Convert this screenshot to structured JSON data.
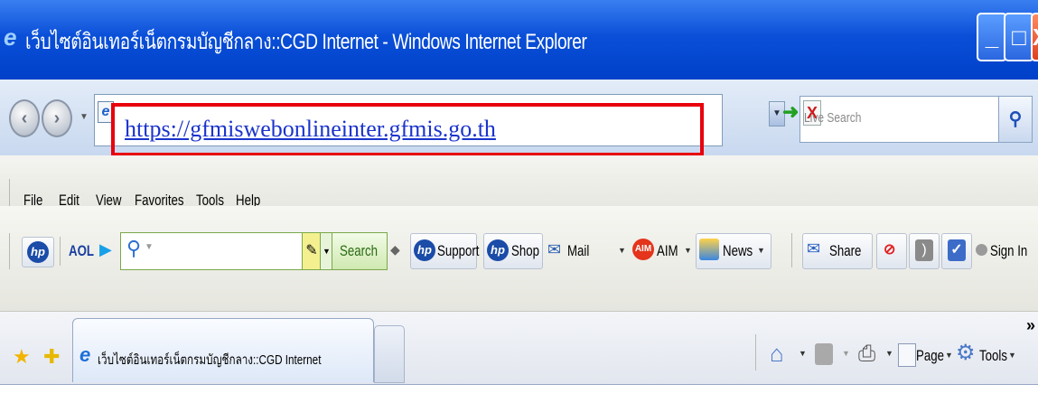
{
  "window": {
    "title": "เว็บไซต์อินเทอร์เน็ตกรมบัญชีกลาง::CGD Internet - Windows Internet Explorer",
    "minimize_label": "_",
    "maximize_label": "□",
    "close_label": "X"
  },
  "address": {
    "url": "https://gfmiswebonlineinter.gfmis.go.th",
    "highlight_color": "#e8000d",
    "search_placeholder": "Live Search"
  },
  "menu": {
    "items": [
      "File",
      "Edit",
      "View",
      "Favorites",
      "Tools",
      "Help"
    ]
  },
  "aol_toolbar": {
    "aol_label": "AOL",
    "search_button": "Search",
    "buttons": [
      "Support",
      "Shop",
      "Mail",
      "AIM",
      "News",
      "Share",
      "Sign In"
    ]
  },
  "tabs": {
    "active_tab_title": "เว็บไซต์อินเทอร์เน็ตกรมบัญชีกลาง::CGD Internet"
  },
  "command_bar": {
    "page_label": "Page",
    "tools_label": "Tools",
    "overflow_label": "»"
  },
  "colors": {
    "titlebar": "#0a4fd8",
    "link": "#1a33cc"
  },
  "icons": [
    "ie-icon",
    "back-icon",
    "forward-icon",
    "go-icon",
    "stop-icon",
    "search-icon",
    "hp-icon",
    "favorites-star-icon",
    "add-favorites-icon",
    "home-icon",
    "feeds-icon",
    "print-icon",
    "page-icon",
    "tools-icon"
  ]
}
